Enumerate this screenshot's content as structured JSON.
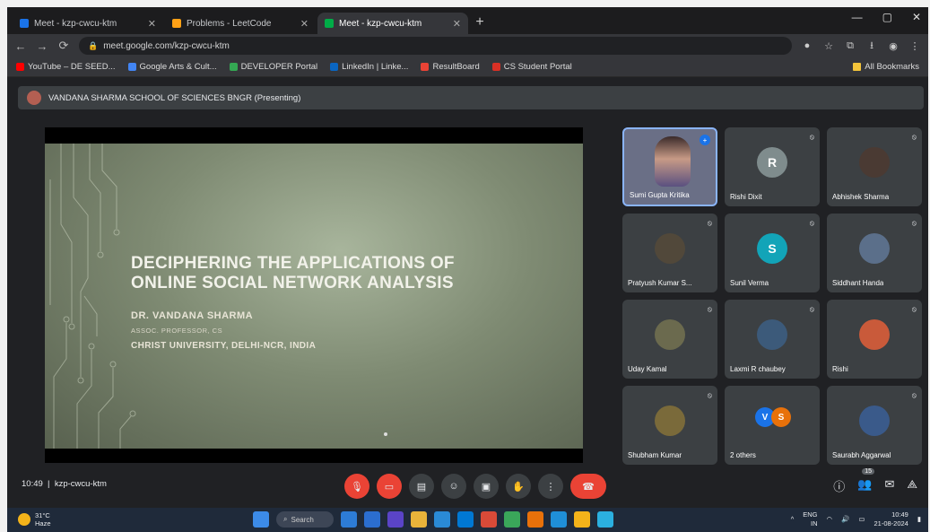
{
  "browser": {
    "tabs": [
      {
        "label": "Meet - kzp-cwcu-ktm",
        "color": "#1a73e8",
        "active": false
      },
      {
        "label": "Problems - LeetCode",
        "color": "#ffa116",
        "active": false
      },
      {
        "label": "Meet - kzp-cwcu-ktm",
        "color": "#00ac47",
        "active": true
      }
    ],
    "new_tab": "+",
    "url": "meet.google.com/kzp-cwcu-ktm",
    "bookmarks": [
      {
        "label": "YouTube – DE SEED...",
        "color": "#ff0000"
      },
      {
        "label": "Google Arts & Cult...",
        "color": "#4285f4"
      },
      {
        "label": "DEVELOPER Portal",
        "color": "#34a853"
      },
      {
        "label": "LinkedIn | Linke...",
        "color": "#0a66c2"
      },
      {
        "label": "ResultBoard",
        "color": "#ea4335"
      },
      {
        "label": "CS Student Portal",
        "color": "#d93025"
      }
    ],
    "bookmarks_right": "All Bookmarks"
  },
  "meet": {
    "presenting_text": "VANDANA SHARMA SCHOOL OF SCIENCES BNGR (Presenting)",
    "slide": {
      "title_line1": "DECIPHERING THE APPLICATIONS OF",
      "title_line2": "ONLINE SOCIAL NETWORK ANALYSIS",
      "author": "DR. VANDANA SHARMA",
      "role": "ASSOC. PROFESSOR, CS",
      "affiliation": "CHRIST UNIVERSITY, DELHI-NCR, INDIA"
    },
    "participants": [
      {
        "name": "Sumi Gupta Kritika",
        "type": "video",
        "av_color": "#6a6f86",
        "initial": ""
      },
      {
        "name": "Rishi Dixit",
        "type": "initial",
        "av_color": "#7f8c8d",
        "initial": "R"
      },
      {
        "name": "Abhishek Sharma",
        "type": "photo",
        "av_color": "#4a3a33",
        "initial": ""
      },
      {
        "name": "Pratyush Kumar S...",
        "type": "photo",
        "av_color": "#51483a",
        "initial": ""
      },
      {
        "name": "Sunil Verma",
        "type": "initial",
        "av_color": "#12a4b8",
        "initial": "S"
      },
      {
        "name": "Siddhant Handa",
        "type": "photo",
        "av_color": "#5b6f8a",
        "initial": ""
      },
      {
        "name": "Uday Kamal",
        "type": "photo",
        "av_color": "#6b6a4e",
        "initial": ""
      },
      {
        "name": "Laxmi R chaubey",
        "type": "photo",
        "av_color": "#3c5a7a",
        "initial": ""
      },
      {
        "name": "Rishi",
        "type": "photo",
        "av_color": "#c95a3a",
        "initial": ""
      },
      {
        "name": "Shubham Kumar",
        "type": "photo",
        "av_color": "#7a6a3a",
        "initial": ""
      },
      {
        "name": "2 others",
        "type": "group",
        "av_color": "#1a73e8",
        "initial": "V",
        "initial2": "S",
        "av_color2": "#e8710a"
      },
      {
        "name": "Saurabh Aggarwal",
        "type": "photo",
        "av_color": "#3a5a8a",
        "initial": ""
      }
    ],
    "clock": "10:49",
    "meeting_code": "kzp-cwcu-ktm",
    "people_count": "15"
  },
  "taskbar": {
    "weather_temp": "31°C",
    "weather_desc": "Haze",
    "search_label": "Search",
    "apps": [
      "#3c8be8",
      "#2d7cd6",
      "#2b6ed0",
      "#5a44c7",
      "#e8b33a",
      "#2a8ad6",
      "#0078d4",
      "#d84a38",
      "#3aa65a",
      "#e8710a",
      "#1f8fd8",
      "#f3b31a",
      "#2bb0e0"
    ],
    "lang": "ENG\nIN",
    "time": "10:49",
    "date": "21-08-2024"
  }
}
